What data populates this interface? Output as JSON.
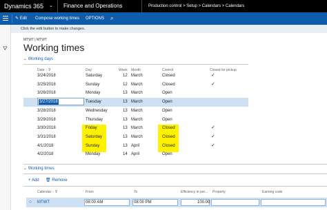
{
  "topbar": {
    "app_name": "Dynamics 365",
    "module": "Finance and Operations",
    "breadcrumb": "Production control  >  Setup  >  Calendars  >  Calendars"
  },
  "actionbar": {
    "edit_label": "Edit",
    "compose_label": "Compose working times",
    "options_label": "OPTIONS"
  },
  "message": "Click the edit button to make changes.",
  "page": {
    "breadcrumb": "MTWT | MTWT",
    "title": "Working times"
  },
  "working_days": {
    "section_label": "Working days",
    "columns": [
      "Date",
      "Day",
      "Week",
      "Month",
      "Control",
      "Closed for pickup"
    ],
    "rows": [
      {
        "date": "3/24/2018",
        "day": "Saturday",
        "week": "12",
        "month": "March",
        "control": "Closed",
        "closed_for_pickup": true
      },
      {
        "date": "3/25/2018",
        "day": "Sunday",
        "week": "12",
        "month": "March",
        "control": "Closed",
        "closed_for_pickup": true
      },
      {
        "date": "3/26/2018",
        "day": "Monday",
        "week": "13",
        "month": "March",
        "control": "Open",
        "closed_for_pickup": false
      },
      {
        "date": "3/27/2018",
        "day": "Tuesday",
        "week": "13",
        "month": "March",
        "control": "Open",
        "closed_for_pickup": false
      },
      {
        "date": "3/28/2018",
        "day": "Wednesday",
        "week": "13",
        "month": "March",
        "control": "Open",
        "closed_for_pickup": false
      },
      {
        "date": "3/29/2018",
        "day": "Thursday",
        "week": "13",
        "month": "March",
        "control": "Open",
        "closed_for_pickup": false
      },
      {
        "date": "3/30/2018",
        "day": "Friday",
        "week": "13",
        "month": "March",
        "control": "Closed",
        "closed_for_pickup": true
      },
      {
        "date": "3/31/2018",
        "day": "Saturday",
        "week": "13",
        "month": "March",
        "control": "Closed",
        "closed_for_pickup": true
      },
      {
        "date": "4/1/2018",
        "day": "Sunday",
        "week": "13",
        "month": "April",
        "control": "Closed",
        "closed_for_pickup": true
      },
      {
        "date": "4/2/2018",
        "day": "Monday",
        "week": "14",
        "month": "April",
        "control": "Open",
        "closed_for_pickup": false
      }
    ]
  },
  "working_times": {
    "section_label": "Working times",
    "add_label": "Add",
    "remove_label": "Remove",
    "columns": [
      "Calendar",
      "From",
      "To",
      "Efficiency in per...",
      "Property",
      "Earning code"
    ],
    "row": {
      "calendar": "MTWT",
      "from": "08:00 AM",
      "to": "08:00 PM",
      "efficiency": "100.00"
    }
  },
  "colors": {
    "brand": "#0f5ca8",
    "highlight": "#fff200",
    "selected_row": "#cde0f4"
  }
}
